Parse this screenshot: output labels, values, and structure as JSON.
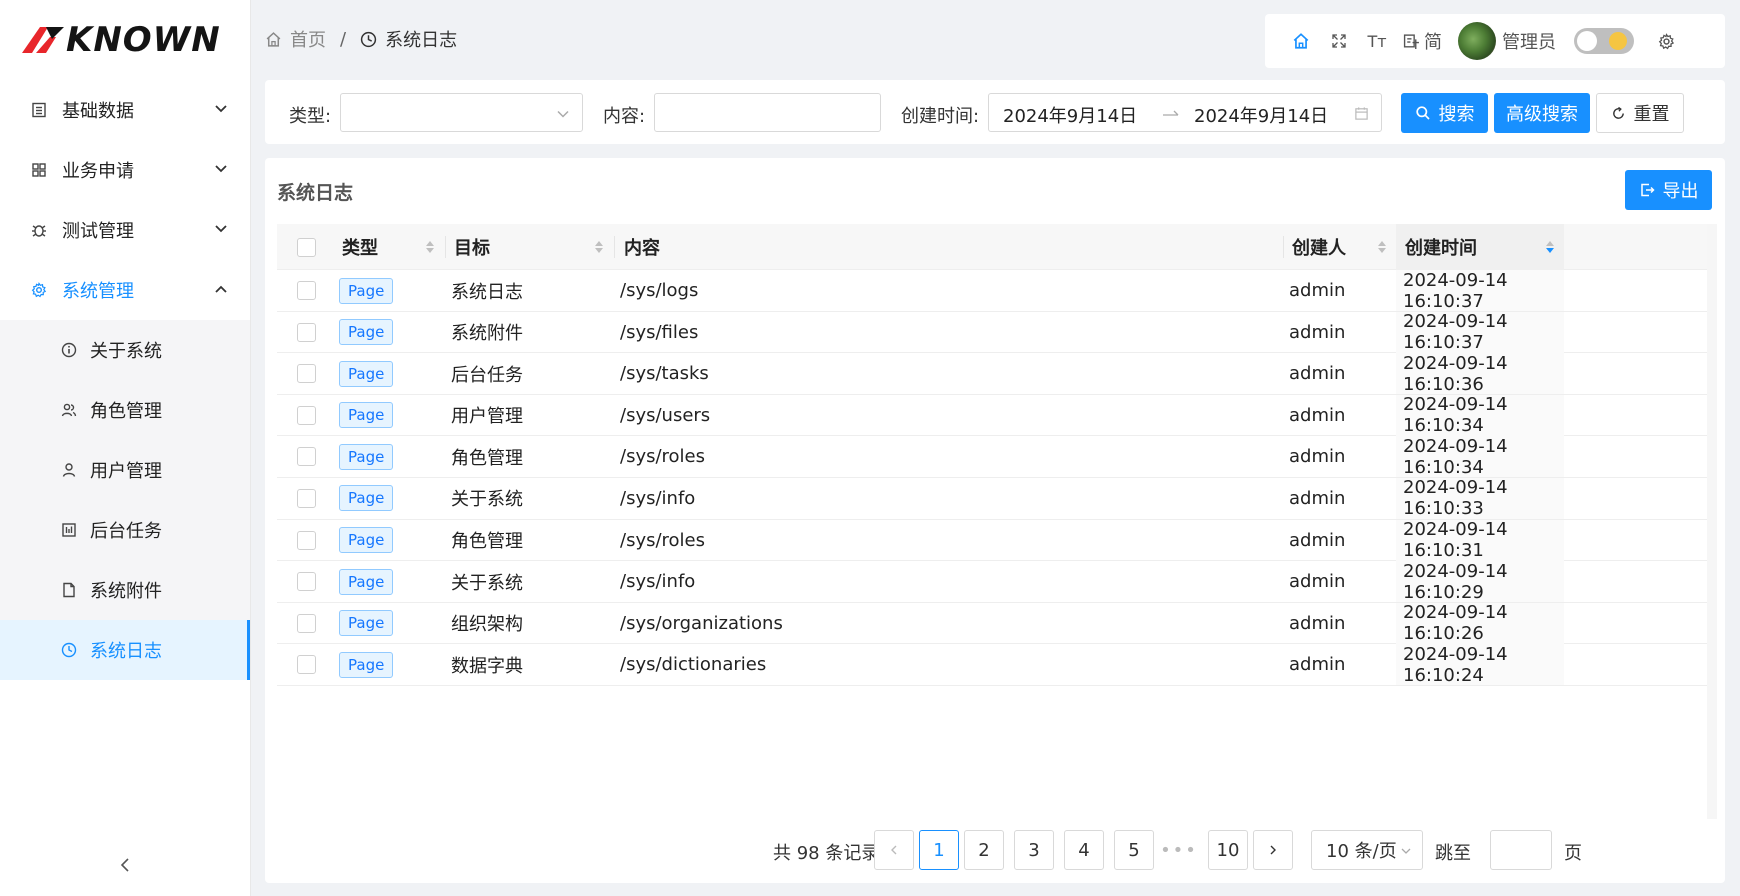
{
  "brand": {
    "logo_text": "KNOWN",
    "logo_color": "#e8262b"
  },
  "colors": {
    "primary": "#1890ff",
    "tag_bg": "#e6f4ff",
    "tag_border": "#91caff"
  },
  "sidebar": {
    "groups": [
      {
        "label": "基础数据",
        "icon": "list-icon",
        "expanded": false
      },
      {
        "label": "业务申请",
        "icon": "grid-icon",
        "expanded": false
      },
      {
        "label": "测试管理",
        "icon": "bug-icon",
        "expanded": false
      },
      {
        "label": "系统管理",
        "icon": "gear-icon",
        "expanded": true
      }
    ],
    "sub_items": [
      {
        "label": "关于系统",
        "icon": "info-icon"
      },
      {
        "label": "角色管理",
        "icon": "users-icon"
      },
      {
        "label": "用户管理",
        "icon": "user-icon"
      },
      {
        "label": "后台任务",
        "icon": "task-icon"
      },
      {
        "label": "系统附件",
        "icon": "file-icon"
      },
      {
        "label": "系统日志",
        "icon": "clock-icon",
        "selected": true
      }
    ],
    "collapse_icon": "chevron-left-icon"
  },
  "breadcrumb": {
    "home": "首页",
    "separator": "/",
    "current": "系统日志"
  },
  "toolbar": {
    "lang_label": "简",
    "font_label": "Tт",
    "user_name": "管理员"
  },
  "filter": {
    "type_label": "类型:",
    "content_label": "内容:",
    "time_label": "创建时间:",
    "date_start": "2024年9月14日",
    "date_end": "2024年9月14日",
    "search_label": "搜索",
    "advanced_label": "高级搜索",
    "reset_label": "重置"
  },
  "card": {
    "title": "系统日志",
    "export_label": "导出"
  },
  "table": {
    "columns": [
      "类型",
      "目标",
      "内容",
      "创建人",
      "创建时间"
    ],
    "rows": [
      {
        "type": "Page",
        "target": "系统日志",
        "content": "/sys/logs",
        "creator": "admin",
        "time": "2024-09-14 16:10:37"
      },
      {
        "type": "Page",
        "target": "系统附件",
        "content": "/sys/files",
        "creator": "admin",
        "time": "2024-09-14 16:10:37"
      },
      {
        "type": "Page",
        "target": "后台任务",
        "content": "/sys/tasks",
        "creator": "admin",
        "time": "2024-09-14 16:10:36"
      },
      {
        "type": "Page",
        "target": "用户管理",
        "content": "/sys/users",
        "creator": "admin",
        "time": "2024-09-14 16:10:34"
      },
      {
        "type": "Page",
        "target": "角色管理",
        "content": "/sys/roles",
        "creator": "admin",
        "time": "2024-09-14 16:10:34"
      },
      {
        "type": "Page",
        "target": "关于系统",
        "content": "/sys/info",
        "creator": "admin",
        "time": "2024-09-14 16:10:33"
      },
      {
        "type": "Page",
        "target": "角色管理",
        "content": "/sys/roles",
        "creator": "admin",
        "time": "2024-09-14 16:10:31"
      },
      {
        "type": "Page",
        "target": "关于系统",
        "content": "/sys/info",
        "creator": "admin",
        "time": "2024-09-14 16:10:29"
      },
      {
        "type": "Page",
        "target": "组织架构",
        "content": "/sys/organizations",
        "creator": "admin",
        "time": "2024-09-14 16:10:26"
      },
      {
        "type": "Page",
        "target": "数据字典",
        "content": "/sys/dictionaries",
        "creator": "admin",
        "time": "2024-09-14 16:10:24"
      }
    ]
  },
  "pagination": {
    "total_text": "共 98 条记录",
    "prev": "<",
    "next": ">",
    "pages": [
      "1",
      "2",
      "3",
      "4",
      "5"
    ],
    "ellipsis": "•••",
    "last_page": "10",
    "current_page": "1",
    "page_size": "10 条/页",
    "jump_label": "跳至",
    "page_suffix": "页"
  }
}
